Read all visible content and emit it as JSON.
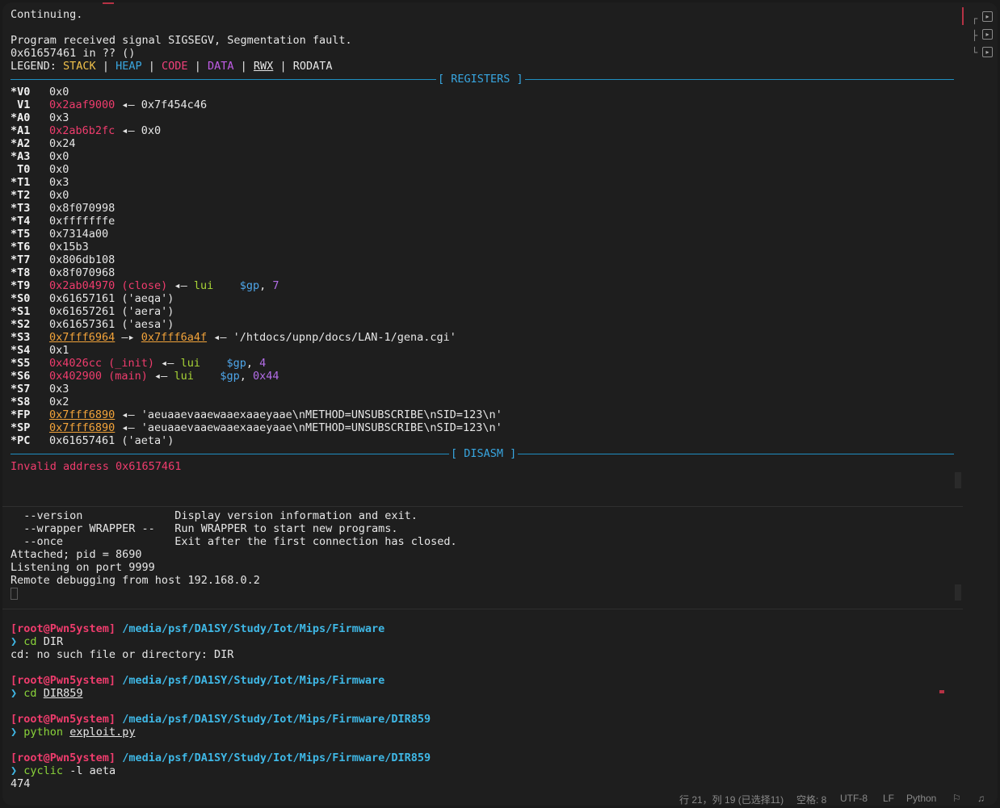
{
  "gdb": {
    "continuing": "Continuing.",
    "signal_msg": "Program received signal SIGSEGV, Segmentation fault.",
    "location": "0x61657461 in ?? ()",
    "legend": {
      "prefix": "LEGEND:",
      "stack": "STACK",
      "heap": "HEAP",
      "code": "CODE",
      "data": "DATA",
      "rwx": "RWX",
      "rodata": "RODATA",
      "sep": "|"
    },
    "registers_header": "[ REGISTERS ]",
    "disasm_header": "[ DISASM ]",
    "invalid_address": "Invalid address 0x61657461",
    "registers": [
      {
        "name": "*V0",
        "parts": [
          [
            "0x0",
            ""
          ]
        ]
      },
      {
        "name": " V1",
        "parts": [
          [
            "0x2aaf9000",
            "c-red"
          ],
          [
            " ◂— 0x7f454c46",
            ""
          ]
        ]
      },
      {
        "name": "*A0",
        "parts": [
          [
            "0x3",
            ""
          ]
        ]
      },
      {
        "name": "*A1",
        "parts": [
          [
            "0x2ab6b2fc",
            "c-red"
          ],
          [
            " ◂— 0x0",
            ""
          ]
        ]
      },
      {
        "name": "*A2",
        "parts": [
          [
            "0x24",
            ""
          ]
        ]
      },
      {
        "name": "*A3",
        "parts": [
          [
            "0x0",
            ""
          ]
        ]
      },
      {
        "name": " T0",
        "parts": [
          [
            "0x0",
            ""
          ]
        ]
      },
      {
        "name": "*T1",
        "parts": [
          [
            "0x3",
            ""
          ]
        ]
      },
      {
        "name": "*T2",
        "parts": [
          [
            "0x0",
            ""
          ]
        ]
      },
      {
        "name": "*T3",
        "parts": [
          [
            "0x8f070998",
            ""
          ]
        ]
      },
      {
        "name": "*T4",
        "parts": [
          [
            "0xfffffffe",
            ""
          ]
        ]
      },
      {
        "name": "*T5",
        "parts": [
          [
            "0x7314a00",
            ""
          ]
        ]
      },
      {
        "name": "*T6",
        "parts": [
          [
            "0x15b3",
            ""
          ]
        ]
      },
      {
        "name": "*T7",
        "parts": [
          [
            "0x806db108",
            ""
          ]
        ]
      },
      {
        "name": "*T8",
        "parts": [
          [
            "0x8f070968",
            ""
          ]
        ]
      },
      {
        "name": "*T9",
        "parts": [
          [
            "0x2ab04970 (close)",
            "c-red"
          ],
          [
            " ◂— ",
            ""
          ],
          [
            "lui",
            "c-green"
          ],
          [
            "    ",
            ""
          ],
          [
            "$gp",
            "c-cyan"
          ],
          [
            ", ",
            ""
          ],
          [
            "7",
            "c-purple"
          ]
        ]
      },
      {
        "name": "*S0",
        "parts": [
          [
            "0x61657161 ('aeqa')",
            ""
          ]
        ]
      },
      {
        "name": "*S1",
        "parts": [
          [
            "0x61657261 ('aera')",
            ""
          ]
        ]
      },
      {
        "name": "*S2",
        "parts": [
          [
            "0x61657361 ('aesa')",
            ""
          ]
        ]
      },
      {
        "name": "*S3",
        "parts": [
          [
            "0x7fff6964",
            "c-yellow-u"
          ],
          [
            " —▸ ",
            ""
          ],
          [
            "0x7fff6a4f",
            "c-yellow-u"
          ],
          [
            " ◂— '/htdocs/upnp/docs/LAN-1/gena.cgi'",
            ""
          ]
        ]
      },
      {
        "name": "*S4",
        "parts": [
          [
            "0x1",
            ""
          ]
        ]
      },
      {
        "name": "*S5",
        "parts": [
          [
            "0x4026cc (_init)",
            "c-red"
          ],
          [
            " ◂— ",
            ""
          ],
          [
            "lui",
            "c-green"
          ],
          [
            "    ",
            ""
          ],
          [
            "$gp",
            "c-cyan"
          ],
          [
            ", ",
            ""
          ],
          [
            "4",
            "c-purple"
          ]
        ]
      },
      {
        "name": "*S6",
        "parts": [
          [
            "0x402900 (main)",
            "c-red"
          ],
          [
            " ◂— ",
            ""
          ],
          [
            "lui",
            "c-green"
          ],
          [
            "    ",
            ""
          ],
          [
            "$gp",
            "c-cyan"
          ],
          [
            ", ",
            ""
          ],
          [
            "0x44",
            "c-purple"
          ]
        ]
      },
      {
        "name": "*S7",
        "parts": [
          [
            "0x3",
            ""
          ]
        ]
      },
      {
        "name": "*S8",
        "parts": [
          [
            "0x2",
            ""
          ]
        ]
      },
      {
        "name": "*FP",
        "parts": [
          [
            "0x7fff6890",
            "c-yellow-u"
          ],
          [
            " ◂— 'aeuaaevaaewaaexaaeyaae\\nMETHOD=UNSUBSCRIBE\\nSID=123\\n'",
            ""
          ]
        ]
      },
      {
        "name": "*SP",
        "parts": [
          [
            "0x7fff6890",
            "c-yellow-u"
          ],
          [
            " ◂— 'aeuaaevaaewaaexaaeyaae\\nMETHOD=UNSUBSCRIBE\\nSID=123\\n'",
            ""
          ]
        ]
      },
      {
        "name": "*PC",
        "parts": [
          [
            "0x61657461 ('aeta')",
            ""
          ]
        ]
      }
    ]
  },
  "gdbserver": {
    "lines": [
      "  --version              Display version information and exit.",
      "  --wrapper WRAPPER --   Run WRAPPER to start new programs.",
      "  --once                 Exit after the first connection has closed.",
      "Attached; pid = 8690",
      "Listening on port 9999",
      "Remote debugging from host 192.168.0.2"
    ]
  },
  "shell": {
    "blocks": [
      {
        "user": "[root@Pwn5ystem]",
        "path": "/media/psf/DA1SY/Study/Iot/Mips/Firmware",
        "cmd": "cd",
        "arg": "DIR",
        "arg_underline": false,
        "output": "cd: no such file or directory: DIR"
      },
      {
        "user": "[root@Pwn5ystem]",
        "path": "/media/psf/DA1SY/Study/Iot/Mips/Firmware",
        "cmd": "cd",
        "arg": "DIR859",
        "arg_underline": true,
        "output": ""
      },
      {
        "user": "[root@Pwn5ystem]",
        "path": "/media/psf/DA1SY/Study/Iot/Mips/Firmware/DIR859",
        "cmd": "python",
        "arg": "exploit.py",
        "arg_underline": true,
        "output": ""
      },
      {
        "user": "[root@Pwn5ystem]",
        "path": "/media/psf/DA1SY/Study/Iot/Mips/Firmware/DIR859",
        "cmd": "cyclic",
        "arg": "-l aeta",
        "arg_underline": false,
        "output": "474"
      }
    ],
    "prompt_char": "❯"
  },
  "status_bar": {
    "position": "行 21，列 19 (已选择11)",
    "spaces": "空格: 8",
    "encoding": "UTF-8",
    "eol": "LF",
    "language": "Python"
  },
  "side_controls": [
    {
      "icon": "split-top-icon",
      "glyph": "▸"
    },
    {
      "icon": "split-middle-icon",
      "glyph": "▸"
    },
    {
      "icon": "split-bottom-icon",
      "glyph": "▸"
    }
  ]
}
